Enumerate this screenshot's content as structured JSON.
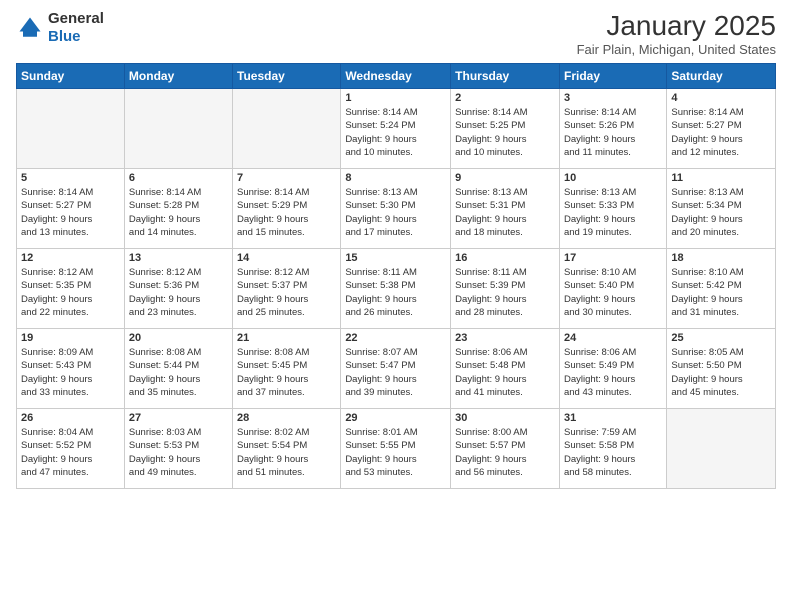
{
  "header": {
    "logo_general": "General",
    "logo_blue": "Blue",
    "month_title": "January 2025",
    "location": "Fair Plain, Michigan, United States"
  },
  "days_of_week": [
    "Sunday",
    "Monday",
    "Tuesday",
    "Wednesday",
    "Thursday",
    "Friday",
    "Saturday"
  ],
  "weeks": [
    [
      {
        "day": "",
        "info": ""
      },
      {
        "day": "",
        "info": ""
      },
      {
        "day": "",
        "info": ""
      },
      {
        "day": "1",
        "info": "Sunrise: 8:14 AM\nSunset: 5:24 PM\nDaylight: 9 hours\nand 10 minutes."
      },
      {
        "day": "2",
        "info": "Sunrise: 8:14 AM\nSunset: 5:25 PM\nDaylight: 9 hours\nand 10 minutes."
      },
      {
        "day": "3",
        "info": "Sunrise: 8:14 AM\nSunset: 5:26 PM\nDaylight: 9 hours\nand 11 minutes."
      },
      {
        "day": "4",
        "info": "Sunrise: 8:14 AM\nSunset: 5:27 PM\nDaylight: 9 hours\nand 12 minutes."
      }
    ],
    [
      {
        "day": "5",
        "info": "Sunrise: 8:14 AM\nSunset: 5:27 PM\nDaylight: 9 hours\nand 13 minutes."
      },
      {
        "day": "6",
        "info": "Sunrise: 8:14 AM\nSunset: 5:28 PM\nDaylight: 9 hours\nand 14 minutes."
      },
      {
        "day": "7",
        "info": "Sunrise: 8:14 AM\nSunset: 5:29 PM\nDaylight: 9 hours\nand 15 minutes."
      },
      {
        "day": "8",
        "info": "Sunrise: 8:13 AM\nSunset: 5:30 PM\nDaylight: 9 hours\nand 17 minutes."
      },
      {
        "day": "9",
        "info": "Sunrise: 8:13 AM\nSunset: 5:31 PM\nDaylight: 9 hours\nand 18 minutes."
      },
      {
        "day": "10",
        "info": "Sunrise: 8:13 AM\nSunset: 5:33 PM\nDaylight: 9 hours\nand 19 minutes."
      },
      {
        "day": "11",
        "info": "Sunrise: 8:13 AM\nSunset: 5:34 PM\nDaylight: 9 hours\nand 20 minutes."
      }
    ],
    [
      {
        "day": "12",
        "info": "Sunrise: 8:12 AM\nSunset: 5:35 PM\nDaylight: 9 hours\nand 22 minutes."
      },
      {
        "day": "13",
        "info": "Sunrise: 8:12 AM\nSunset: 5:36 PM\nDaylight: 9 hours\nand 23 minutes."
      },
      {
        "day": "14",
        "info": "Sunrise: 8:12 AM\nSunset: 5:37 PM\nDaylight: 9 hours\nand 25 minutes."
      },
      {
        "day": "15",
        "info": "Sunrise: 8:11 AM\nSunset: 5:38 PM\nDaylight: 9 hours\nand 26 minutes."
      },
      {
        "day": "16",
        "info": "Sunrise: 8:11 AM\nSunset: 5:39 PM\nDaylight: 9 hours\nand 28 minutes."
      },
      {
        "day": "17",
        "info": "Sunrise: 8:10 AM\nSunset: 5:40 PM\nDaylight: 9 hours\nand 30 minutes."
      },
      {
        "day": "18",
        "info": "Sunrise: 8:10 AM\nSunset: 5:42 PM\nDaylight: 9 hours\nand 31 minutes."
      }
    ],
    [
      {
        "day": "19",
        "info": "Sunrise: 8:09 AM\nSunset: 5:43 PM\nDaylight: 9 hours\nand 33 minutes."
      },
      {
        "day": "20",
        "info": "Sunrise: 8:08 AM\nSunset: 5:44 PM\nDaylight: 9 hours\nand 35 minutes."
      },
      {
        "day": "21",
        "info": "Sunrise: 8:08 AM\nSunset: 5:45 PM\nDaylight: 9 hours\nand 37 minutes."
      },
      {
        "day": "22",
        "info": "Sunrise: 8:07 AM\nSunset: 5:47 PM\nDaylight: 9 hours\nand 39 minutes."
      },
      {
        "day": "23",
        "info": "Sunrise: 8:06 AM\nSunset: 5:48 PM\nDaylight: 9 hours\nand 41 minutes."
      },
      {
        "day": "24",
        "info": "Sunrise: 8:06 AM\nSunset: 5:49 PM\nDaylight: 9 hours\nand 43 minutes."
      },
      {
        "day": "25",
        "info": "Sunrise: 8:05 AM\nSunset: 5:50 PM\nDaylight: 9 hours\nand 45 minutes."
      }
    ],
    [
      {
        "day": "26",
        "info": "Sunrise: 8:04 AM\nSunset: 5:52 PM\nDaylight: 9 hours\nand 47 minutes."
      },
      {
        "day": "27",
        "info": "Sunrise: 8:03 AM\nSunset: 5:53 PM\nDaylight: 9 hours\nand 49 minutes."
      },
      {
        "day": "28",
        "info": "Sunrise: 8:02 AM\nSunset: 5:54 PM\nDaylight: 9 hours\nand 51 minutes."
      },
      {
        "day": "29",
        "info": "Sunrise: 8:01 AM\nSunset: 5:55 PM\nDaylight: 9 hours\nand 53 minutes."
      },
      {
        "day": "30",
        "info": "Sunrise: 8:00 AM\nSunset: 5:57 PM\nDaylight: 9 hours\nand 56 minutes."
      },
      {
        "day": "31",
        "info": "Sunrise: 7:59 AM\nSunset: 5:58 PM\nDaylight: 9 hours\nand 58 minutes."
      },
      {
        "day": "",
        "info": ""
      }
    ]
  ]
}
